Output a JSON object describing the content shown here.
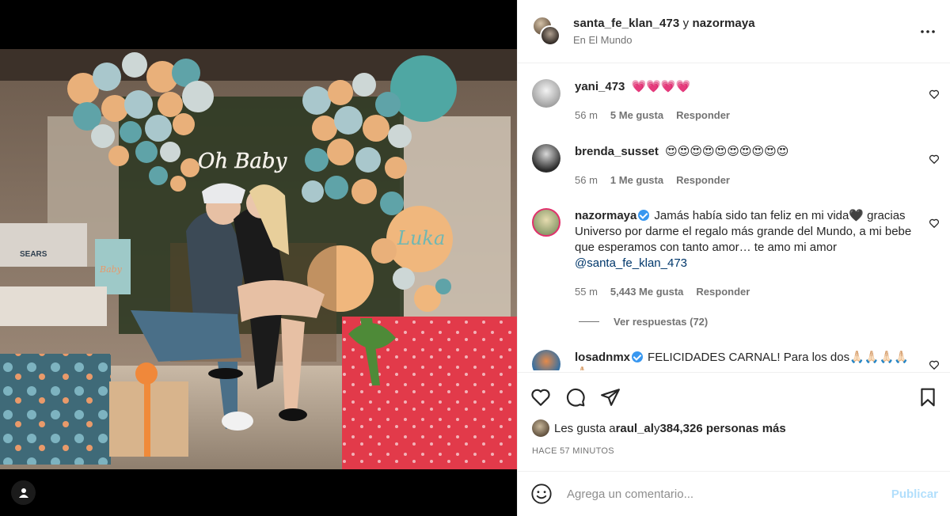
{
  "post": {
    "authors_user1": "santa_fe_klan_473",
    "authors_join": " y ",
    "authors_user2": "nazormaya",
    "location": "En El Mundo",
    "more_icon": "more-horizontal-icon"
  },
  "photo": {
    "sign_neon": "Oh Baby",
    "balloon_name": "Luka",
    "bag_text": "Baby",
    "box_brand": "SEARS"
  },
  "comments": [
    {
      "user": "yani_473",
      "text": "💗💗💗💗",
      "time": "56 m",
      "likes": "5 Me gusta",
      "reply": "Responder"
    },
    {
      "user": "brenda_susset",
      "text": "😍😍😍😍😍😍😍😍😍😍",
      "time": "56 m",
      "likes": "1 Me gusta",
      "reply": "Responder"
    },
    {
      "user": "nazormaya",
      "text": "Jamás había sido tan feliz en mi vida🖤 gracias Universo por darme el regalo más grande del Mundo, a mi bebe que esperamos con tanto amor… te amo mi amor ",
      "mention": "@santa_fe_klan_473",
      "time": "55 m",
      "likes": "5,443 Me gusta",
      "reply": "Responder",
      "view_replies": "Ver respuestas (72)"
    },
    {
      "user": "losadnmx",
      "text": "FELICIDADES CARNAL! Para los dos🙏🏻🙏🏻🙏🏻🙏🏻🙏🏻"
    }
  ],
  "likes": {
    "prefix": "Les gusta a ",
    "user": "raul_al",
    "join": " y ",
    "others": "384,326 personas más"
  },
  "timestamp": "HACE 57 MINUTOS",
  "add_comment": {
    "placeholder": "Agrega un comentario...",
    "publish": "Publicar"
  },
  "colors": {
    "accent_blue": "#3897f0",
    "publish_disabled": "#b2dffc",
    "gift_red": "#e23a4a"
  }
}
